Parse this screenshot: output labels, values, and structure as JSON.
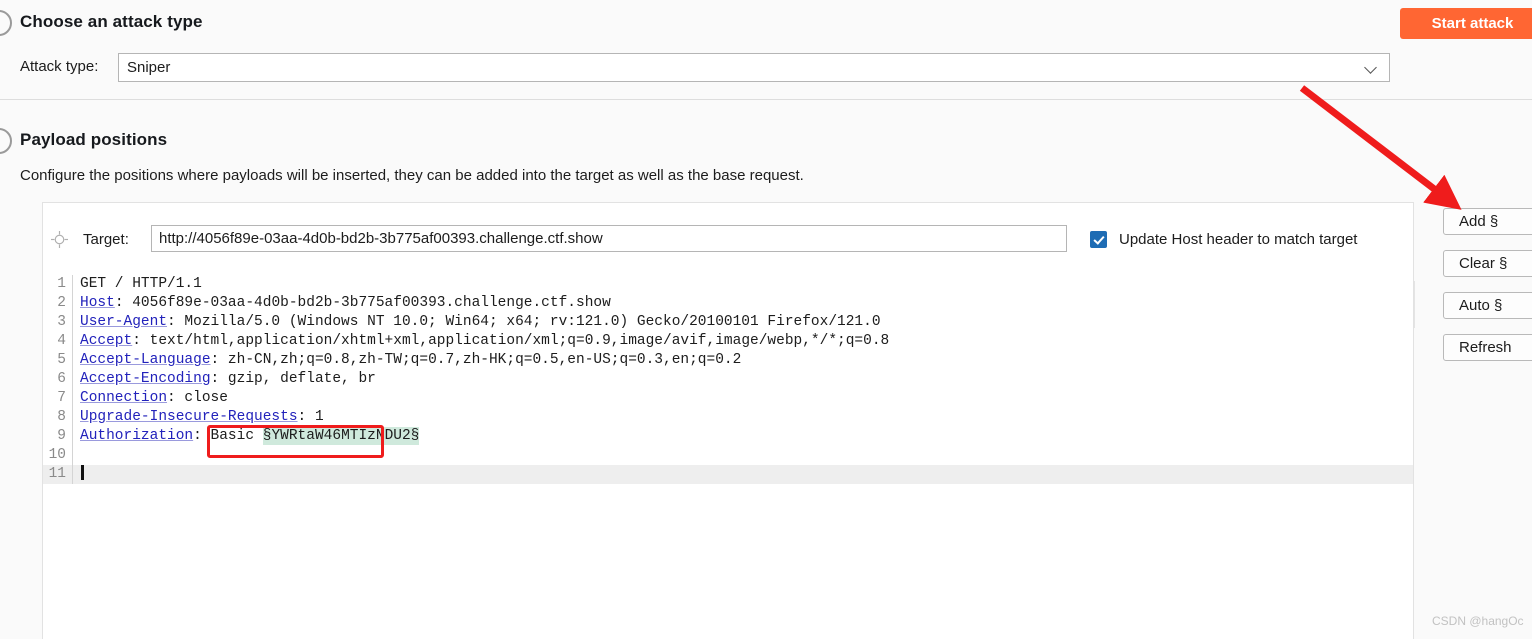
{
  "sections": {
    "attack_type": {
      "title": "Choose an attack type",
      "label": "Attack type:",
      "selected": "Sniper",
      "chevron_icon": "chevron-down-icon"
    },
    "payload_positions": {
      "title": "Payload positions",
      "description": "Configure the positions where payloads will be inserted, they can be added into the target as well as the base request."
    }
  },
  "toolbar": {
    "start_attack_label": "Start attack",
    "start_attack_color": "#ff6633"
  },
  "target": {
    "icon": "crosshair-icon",
    "label": "Target:",
    "url": "http://4056f89e-03aa-4d0b-bd2b-3b775af00393.challenge.ctf.show",
    "update_host_label": "Update Host header to match target",
    "update_host_checked": true,
    "checkbox_color": "#1e6cb4"
  },
  "side_buttons": [
    {
      "label": "Add §"
    },
    {
      "label": "Clear §"
    },
    {
      "label": "Auto §"
    },
    {
      "label": "Refresh"
    }
  ],
  "request_editor": {
    "header_color": "#2222bb",
    "payload_highlight_color": "#cfe9dc",
    "active_line": 11,
    "lines": [
      {
        "n": "1",
        "header": "",
        "rest": "GET / HTTP/1.1"
      },
      {
        "n": "2",
        "header": "Host",
        "rest": ": 4056f89e-03aa-4d0b-bd2b-3b775af00393.challenge.ctf.show"
      },
      {
        "n": "3",
        "header": "User-Agent",
        "rest": ": Mozilla/5.0 (Windows NT 10.0; Win64; x64; rv:121.0) Gecko/20100101 Firefox/121.0"
      },
      {
        "n": "4",
        "header": "Accept",
        "rest": ": text/html,application/xhtml+xml,application/xml;q=0.9,image/avif,image/webp,*/*;q=0.8"
      },
      {
        "n": "5",
        "header": "Accept-Language",
        "rest": ": zh-CN,zh;q=0.8,zh-TW;q=0.7,zh-HK;q=0.5,en-US;q=0.3,en;q=0.2"
      },
      {
        "n": "6",
        "header": "Accept-Encoding",
        "rest": ": gzip, deflate, br"
      },
      {
        "n": "7",
        "header": "Connection",
        "rest": ": close"
      },
      {
        "n": "8",
        "header": "Upgrade-Insecure-Requests",
        "rest": ": 1"
      },
      {
        "n": "9",
        "header": "Authorization",
        "rest": ": Basic ",
        "payload": "§YWRtaW46MTIzNDU2§"
      },
      {
        "n": "10",
        "header": "",
        "rest": ""
      },
      {
        "n": "11",
        "header": "",
        "rest": "",
        "caret": true
      }
    ]
  },
  "watermark": "CSDN @hangOc",
  "annotations": {
    "arrow_color": "#ef1c1c",
    "box_color": "#ef1c1c"
  }
}
